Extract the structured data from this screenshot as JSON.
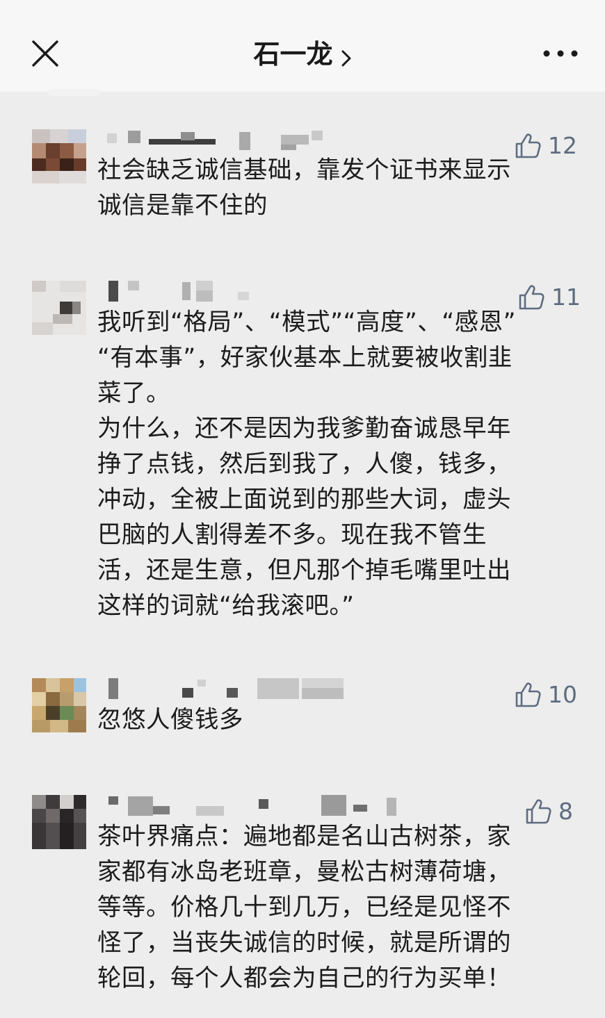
{
  "header": {
    "title": "石一龙",
    "close_icon": "close-icon",
    "chevron_icon": "chevron-right-icon",
    "more_icon": "more-dots-icon"
  },
  "comments": [
    {
      "likes": "12",
      "lines": [
        "社会缺乏诚信基础，靠发个证书来显示",
        "诚信是靠不住的"
      ]
    },
    {
      "likes": "11",
      "lines": [
        "我听到“格局”、“模式”“高度”、“感恩”",
        "“有本事”，好家伙基本上就要被收割韭",
        "菜了。",
        "为什么，还不是因为我爹勤奋诚恳早年",
        "挣了点钱，然后到我了，人傻，钱多，",
        "冲动，全被上面说到的那些大词，虚头",
        "巴脑的人割得差不多。现在我不管生",
        "活，还是生意，但凡那个掉毛嘴里吐出",
        "这样的词就“给我滚吧。”"
      ]
    },
    {
      "likes": "10",
      "lines": [
        "忽悠人傻钱多"
      ]
    },
    {
      "likes": "8",
      "lines": [
        "茶叶界痛点：遍地都是名山古树茶，家",
        "家都有冰岛老班章，曼松古树薄荷塘，",
        "等等。价格几十到几万，已经是见怪不",
        "怪了，当丧失诚信的时候，就是所谓的",
        "轮回，每个人都会为自己的行为买单！"
      ]
    }
  ],
  "like_icon": "thumbs-up-icon",
  "colors": {
    "background": "#ededed",
    "header": "#f7f7f7",
    "text": "#1c1c1c",
    "like": "#5e6c7f"
  }
}
